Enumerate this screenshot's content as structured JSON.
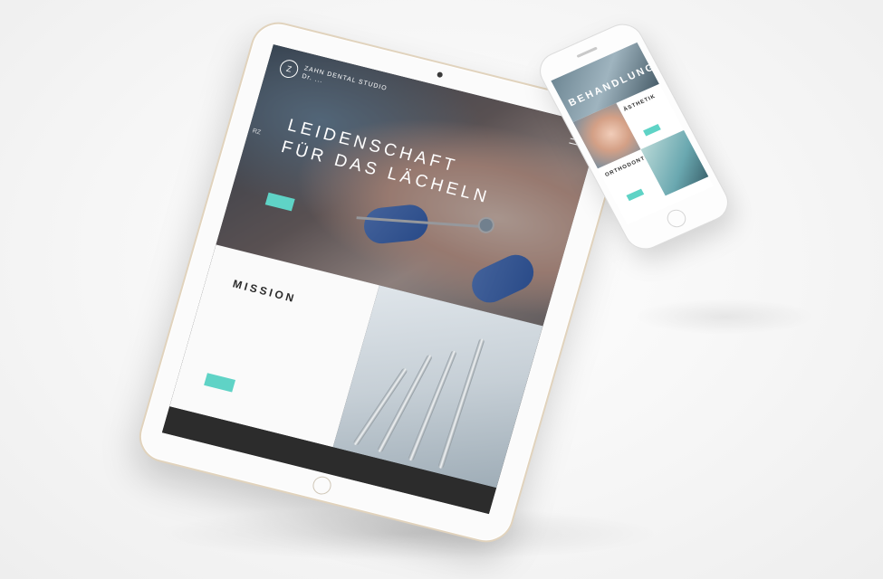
{
  "tablet": {
    "logo": {
      "mark": "Z",
      "line1": "ZAHN DENTAL STUDIO",
      "line2": "Dr. ..."
    },
    "side_tag": "RZ",
    "hero": {
      "title_line1": "LEIDENSCHAFT",
      "title_line2": "FÜR DAS LÄCHELN",
      "text": "",
      "button": ""
    },
    "mission": {
      "title": "MISSION",
      "subtitle": "",
      "text": "",
      "button": ""
    },
    "footer": {
      "text": "",
      "link": "",
      "phone": ""
    }
  },
  "phone": {
    "hero_title": "BEHANDLUNG",
    "items": [
      {
        "label": "ÄSTHETIK"
      },
      {
        "label": "ORTHODONTIE"
      }
    ]
  },
  "colors": {
    "accent": "#5fd3c6",
    "footer_bg": "#2c2c2c",
    "tablet_frame": "#e1d3bd"
  },
  "icons": [
    "logo-icon",
    "hamburger-menu-icon",
    "camera-icon",
    "home-button-icon",
    "speaker-icon"
  ]
}
